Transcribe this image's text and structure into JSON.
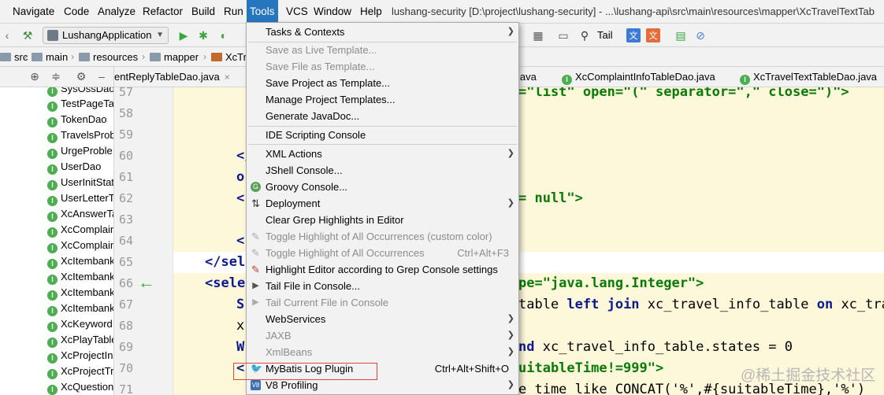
{
  "menubar": {
    "items": [
      "Navigate",
      "Code",
      "Analyze",
      "Refactor",
      "Build",
      "Run",
      "Tools",
      "VCS",
      "Window",
      "Help"
    ],
    "active": "Tools",
    "window_title": "lushang-security [D:\\project\\lushang-security] - ...\\lushang-api\\src\\main\\resources\\mapper\\XcTravelTextTab"
  },
  "toolbar": {
    "run_config": "LushangApplication",
    "tail_label": "Tail",
    "icons": [
      "hammer-icon",
      "run-icon",
      "debug-icon",
      "coverage-icon",
      "stop-icon",
      "project-structure-icon",
      "terminal-icon",
      "search-icon",
      "translate-icon",
      "translate-alt-icon",
      "chart-icon",
      "block-icon"
    ]
  },
  "breadcrumb": {
    "items": [
      "src",
      "main",
      "resources",
      "mapper",
      "XcTr"
    ]
  },
  "project_tree": {
    "items": [
      "SysOssDao",
      "TestPageTa",
      "TokenDao",
      "TravelsProb",
      "UrgeProble",
      "UserDao",
      "UserInitStat",
      "UserLetterT",
      "XcAnswerTa",
      "XcComplain",
      "XcComplain",
      "XcItembank",
      "XcItembank",
      "XcItembank",
      "XcItembank",
      "XcKeyword",
      "XcPlayTable",
      "XcProjectIn",
      "XcProjectTr",
      "XcQuestion"
    ]
  },
  "editor_tabs": {
    "tabs": [
      {
        "label": "entReplyTableDao.java",
        "active": false
      },
      {
        "label": "java",
        "active": false
      },
      {
        "label": "XcComplaintInfoTableDao.java",
        "active": false
      },
      {
        "label": "XcTravelTextTableDao.java",
        "active": false
      }
    ]
  },
  "editor": {
    "line_numbers": [
      "57",
      "58",
      "59",
      "60",
      "61",
      "62",
      "63",
      "64",
      "65",
      "66",
      "67",
      "68",
      "69",
      "70",
      "71"
    ],
    "code": {
      "l57": "=\"list\" open=\"(\" separator=\",\" close=\")\">",
      "l60": "</",
      "l61": "o",
      "l62a": "<",
      "l62b": "= null\">",
      "l64": "<",
      "l65": "</sele",
      "l66a": "<sele",
      "l66b": "pe=\"java.lang.Integer\">",
      "l67a": "S",
      "l67b": "table ",
      "l67c": "left join",
      "l67d": " xc_travel_info_table ",
      "l67e": "on",
      "l67f": " xc_trav",
      "l68": "x",
      "l69a": "W",
      "l69b": "nd",
      "l69c": " xc_travel_info_table.states = 0",
      "l70a": "<",
      "l70b": "uitableTime!=999\">",
      "l71": "e time like CONCAT('%',#{suitableTime},'%')"
    }
  },
  "tools_menu": {
    "items": [
      {
        "label": "Tasks & Contexts",
        "submenu": true,
        "disabled": false
      },
      {
        "label": "Save as Live Template...",
        "disabled": true
      },
      {
        "label": "Save File as Template...",
        "disabled": true
      },
      {
        "label": "Save Project as Template...",
        "disabled": false
      },
      {
        "label": "Manage Project Templates...",
        "disabled": false
      },
      {
        "label": "Generate JavaDoc...",
        "disabled": false
      },
      {
        "label": "IDE Scripting Console",
        "disabled": false
      },
      {
        "label": "XML Actions",
        "submenu": true,
        "disabled": false
      },
      {
        "label": "JShell Console...",
        "disabled": false
      },
      {
        "label": "Groovy Console...",
        "disabled": false
      },
      {
        "label": "Deployment",
        "submenu": true,
        "disabled": false
      },
      {
        "label": "Clear Grep Highlights in Editor",
        "disabled": false
      },
      {
        "label": "Toggle Highlight of All Occurrences (custom color)",
        "disabled": true
      },
      {
        "label": "Toggle Highlight of All Occurrences",
        "shortcut": "Ctrl+Alt+F3",
        "disabled": true
      },
      {
        "label": "Highlight Editor according to Grep Console settings",
        "disabled": false
      },
      {
        "label": "Tail File in Console...",
        "disabled": false
      },
      {
        "label": "Tail Current File in Console",
        "disabled": true
      },
      {
        "label": "WebServices",
        "submenu": true,
        "disabled": false
      },
      {
        "label": "JAXB",
        "submenu": true,
        "disabled": true
      },
      {
        "label": "XmlBeans",
        "submenu": true,
        "disabled": true
      },
      {
        "label": "MyBatis Log Plugin",
        "shortcut": "Ctrl+Alt+Shift+O",
        "disabled": false
      },
      {
        "label": "V8 Profiling",
        "submenu": true,
        "disabled": false
      }
    ]
  },
  "watermark": "@稀土掘金技术社区",
  "colors": {
    "menu_active": "#2675bf",
    "editor_bg": "#fdf8d9",
    "highlight_box": "#e0453b",
    "xml_tag": "#0b1a8f",
    "xml_string": "#087a08"
  }
}
